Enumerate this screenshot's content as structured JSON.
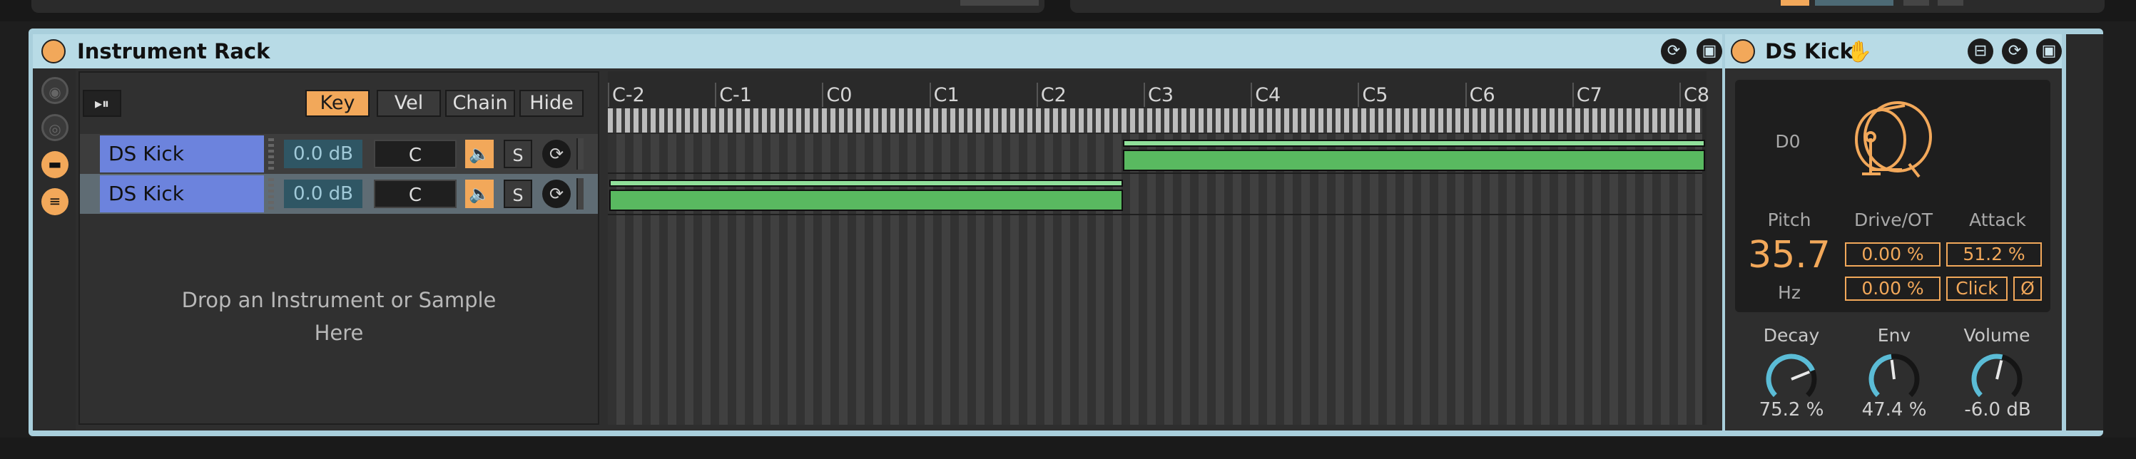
{
  "rack": {
    "title": "Instrument Rack",
    "buttons": {
      "key": "Key",
      "vel": "Vel",
      "chain": "Chain",
      "hide": "Hide"
    },
    "chains": [
      {
        "name": "DS Kick",
        "volume": "0.0 dB",
        "key": "C",
        "speaker": "🔈",
        "solo": "S",
        "ring": "⟳"
      },
      {
        "name": "DS Kick",
        "volume": "0.0 dB",
        "key": "C",
        "speaker": "🔈",
        "solo": "S",
        "ring": "⟳"
      }
    ],
    "drop_hint_line1": "Drop an Instrument or Sample",
    "drop_hint_line2": "Here",
    "octaves": [
      "C-2",
      "C-1",
      "C0",
      "C1",
      "C2",
      "C3",
      "C4",
      "C5",
      "C6",
      "C7",
      "C8"
    ],
    "header_icons": {
      "hot_swap": "⟳",
      "save": "▣"
    }
  },
  "device": {
    "title": "DS Kick",
    "hand_icon": "✋",
    "note": "D0",
    "pitch_label": "Pitch",
    "pitch_value": "35.7",
    "pitch_unit": "Hz",
    "drive_label": "Drive/OT",
    "drive_value": "0.00 %",
    "ot_value": "0.00 %",
    "attack_label": "Attack",
    "attack_value": "51.2 %",
    "click_label": "Click",
    "phase_label": "Ø",
    "decay_label": "Decay",
    "decay_value": "75.2 %",
    "decay_level": 0.752,
    "env_label": "Env",
    "env_value": "47.4 %",
    "env_level": 0.474,
    "volume_label": "Volume",
    "volume_value": "-6.0 dB",
    "volume_level": 0.55,
    "header_icons": {
      "fold": "⊟",
      "hot_swap": "⟳",
      "save": "▣"
    }
  },
  "colors": {
    "accent_orange": "#f2a85a",
    "chain_blue": "#6c83dd",
    "zone_green": "#59b960",
    "title_bar": "#b8dbe6",
    "knob_cyan": "#5bbcd6"
  }
}
